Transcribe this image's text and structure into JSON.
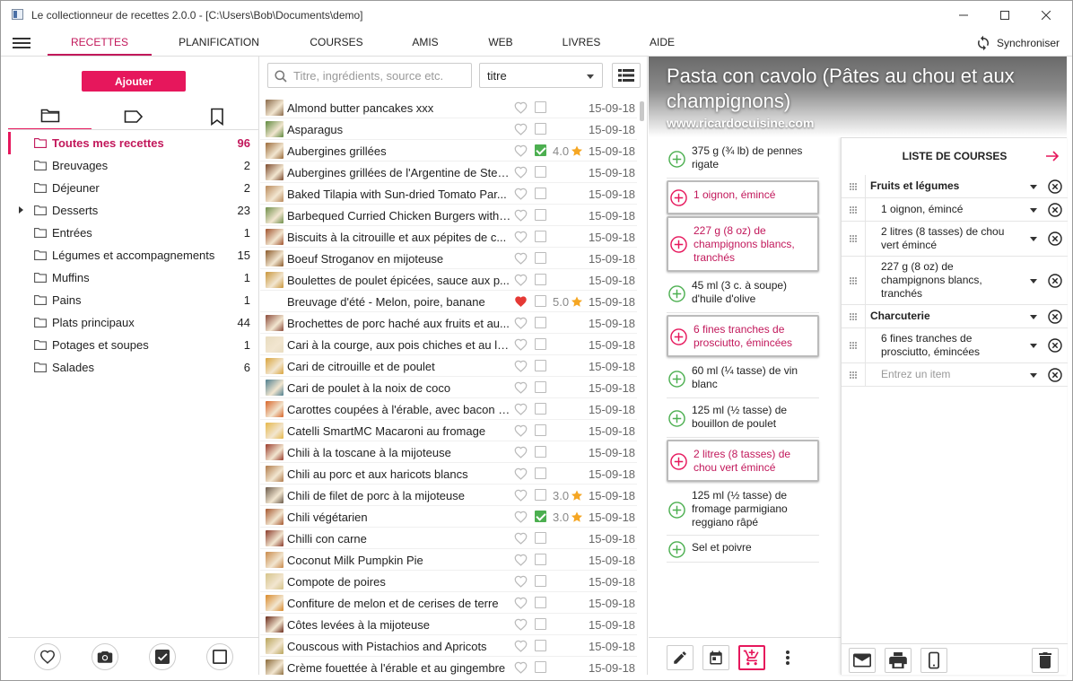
{
  "window": {
    "title": "Le collectionneur de recettes 2.0.0 -  [C:\\Users\\Bob\\Documents\\demo]"
  },
  "nav": {
    "tabs": [
      {
        "label": "RECETTES",
        "active": true
      },
      {
        "label": "PLANIFICATION"
      },
      {
        "label": "COURSES"
      },
      {
        "label": "AMIS"
      },
      {
        "label": "WEB"
      },
      {
        "label": "LIVRES"
      },
      {
        "label": "AIDE"
      }
    ],
    "sync_label": "Synchroniser"
  },
  "left": {
    "add_label": "Ajouter",
    "categories": [
      {
        "label": "Toutes mes recettes",
        "count": "96",
        "active": true
      },
      {
        "label": "Breuvages",
        "count": "2"
      },
      {
        "label": "Déjeuner",
        "count": "2"
      },
      {
        "label": "Desserts",
        "count": "23",
        "expandable": true
      },
      {
        "label": "Entrées",
        "count": "1"
      },
      {
        "label": "Légumes et accompagnements",
        "count": "15"
      },
      {
        "label": "Muffins",
        "count": "1"
      },
      {
        "label": "Pains",
        "count": "1"
      },
      {
        "label": "Plats principaux",
        "count": "44"
      },
      {
        "label": "Potages et soupes",
        "count": "1"
      },
      {
        "label": "Salades",
        "count": "6"
      }
    ]
  },
  "search": {
    "placeholder": "Titre, ingrédients, source etc.",
    "sort_value": "titre"
  },
  "recipes": [
    {
      "name": "Almond butter pancakes xxx",
      "date": "15-09-18",
      "color": "#8a6a4a"
    },
    {
      "name": "Asparagus",
      "date": "15-09-18",
      "color": "#5f8a3e"
    },
    {
      "name": "Aubergines grillées",
      "date": "15-09-18",
      "rating": "4.0",
      "checked": true,
      "color": "#9b6b3a"
    },
    {
      "name": "Aubergines grillées de l'Argentine de Stev...",
      "date": "15-09-18",
      "color": "#7c4a2d"
    },
    {
      "name": "Baked Tilapia with Sun-dried Tomato Par...",
      "date": "15-09-18",
      "color": "#b9895a"
    },
    {
      "name": "Barbequed Curried Chicken Burgers with ...",
      "date": "15-09-18",
      "color": "#6f8f4a"
    },
    {
      "name": "Biscuits à la citrouille et aux pépites de c...",
      "date": "15-09-18",
      "color": "#a0522d"
    },
    {
      "name": "Boeuf Stroganov en mijoteuse",
      "date": "15-09-18",
      "color": "#8b5a2b"
    },
    {
      "name": "Boulettes de poulet épicées, sauce aux p...",
      "date": "15-09-18",
      "color": "#c9963b"
    },
    {
      "name": "Breuvage d'été - Melon, poire, banane",
      "date": "15-09-18",
      "rating": "5.0",
      "favorite": true,
      "color": ""
    },
    {
      "name": "Brochettes de porc haché aux fruits et au...",
      "date": "15-09-18",
      "color": "#8b4a3a"
    },
    {
      "name": "Cari à la courge, aux pois chiches et au lai...",
      "date": "15-09-18",
      "color": "#e8dcc0"
    },
    {
      "name": "Cari de citrouille et de poulet",
      "date": "15-09-18",
      "color": "#d9a43c"
    },
    {
      "name": "Cari de poulet à la noix de coco",
      "date": "15-09-18",
      "color": "#4f7f8f"
    },
    {
      "name": "Carottes coupées à l'érable, avec bacon e...",
      "date": "15-09-18",
      "color": "#d8662a"
    },
    {
      "name": "Catelli SmartMC Macaroni au fromage",
      "date": "15-09-18",
      "color": "#e6b84a"
    },
    {
      "name": "Chili à la toscane à la mijoteuse",
      "date": "15-09-18",
      "color": "#9a3b2b"
    },
    {
      "name": "Chili au porc et aux haricots blancs",
      "date": "15-09-18",
      "color": "#b07a4a"
    },
    {
      "name": "Chili de filet de porc à la mijoteuse",
      "date": "15-09-18",
      "rating": "3.0",
      "color": "#6a5a4a"
    },
    {
      "name": "Chili végétarien",
      "date": "15-09-18",
      "rating": "3.0",
      "checked": true,
      "color": "#a5562e"
    },
    {
      "name": "Chilli con carne",
      "date": "15-09-18",
      "color": "#8a3a2a"
    },
    {
      "name": "Coconut Milk Pumpkin Pie",
      "date": "15-09-18",
      "color": "#c98a4a"
    },
    {
      "name": "Compote de poires",
      "date": "15-09-18",
      "color": "#d6c48a"
    },
    {
      "name": "Confiture de melon et de cerises de terre",
      "date": "15-09-18",
      "color": "#d98a2a"
    },
    {
      "name": "Côtes levées à la mijoteuse",
      "date": "15-09-18",
      "color": "#6a2a1a"
    },
    {
      "name": "Couscous with Pistachios and Apricots",
      "date": "15-09-18",
      "color": "#b8a45a"
    },
    {
      "name": "Crème fouettée à l'érable et au gingembre",
      "date": "15-09-18",
      "color": "#8a6a3a"
    }
  ],
  "recipe": {
    "title": "Pasta con cavolo (Pâtes au chou et aux champignons)",
    "source": "www.ricardocuisine.com",
    "ingredients": [
      {
        "text": "375 g (¾ lb) de pennes rigate"
      },
      {
        "text": "1 oignon, émincé",
        "selected": true
      },
      {
        "text": "227 g (8 oz) de champignons blancs, tranchés",
        "selected": true
      },
      {
        "text": "45 ml (3 c. à soupe) d'huile d'olive"
      },
      {
        "text": "6 fines tranches de prosciutto, émincées",
        "selected": true
      },
      {
        "text": "60 ml (¼ tasse) de vin blanc"
      },
      {
        "text": "125 ml (½ tasse) de bouillon de poulet"
      },
      {
        "text": "2 litres (8 tasses) de chou vert émincé",
        "selected": true
      },
      {
        "text": "125 ml (½ tasse) de fromage parmigiano reggiano râpé"
      },
      {
        "text": "Sel et poivre"
      }
    ]
  },
  "shopping": {
    "title": "LISTE DE COURSES",
    "rows": [
      {
        "text": "Fruits et légumes",
        "category": true
      },
      {
        "text": "1 oignon, émincé"
      },
      {
        "text": "2 litres (8 tasses) de chou vert émincé"
      },
      {
        "text": "227 g (8 oz) de champignons blancs, tranchés"
      },
      {
        "text": "Charcuterie",
        "category": true
      },
      {
        "text": "6 fines tranches de prosciutto, émincées"
      }
    ],
    "entry_placeholder": "Entrez un item"
  },
  "colors": {
    "accent": "#e6175c",
    "accent_text": "#c2185b",
    "green": "#4caf50",
    "star": "#f5a623"
  }
}
